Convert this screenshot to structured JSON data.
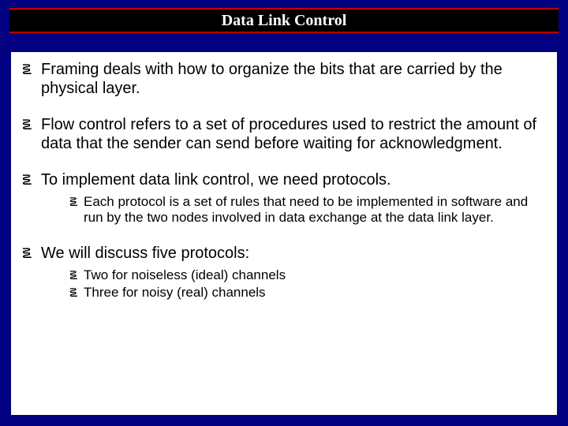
{
  "title": "Data Link Control",
  "bullets": {
    "b1": "Framing deals with how to organize the bits that are carried by the physical layer.",
    "b2": "Flow control refers to a set of procedures used to restrict the amount of data that the sender can send before waiting for acknowledgment.",
    "b3": "To implement data link control, we need protocols.",
    "b3s1": "Each protocol is a set of rules that need to be implemented in software and run by the two nodes involved in data exchange at the data link layer.",
    "b4": "We will discuss five protocols:",
    "b4s1": "Two for noiseless (ideal) channels",
    "b4s2": "Three for noisy (real) channels"
  }
}
